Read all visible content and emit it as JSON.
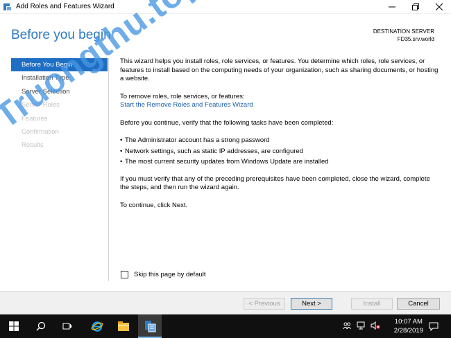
{
  "window": {
    "title": "Add Roles and Features Wizard",
    "controls": [
      "minimize-icon",
      "maximize-icon",
      "close-icon"
    ]
  },
  "header": {
    "page_title": "Before you begin",
    "destination_label": "DESTINATION SERVER",
    "destination_value": "FD35.srv.world"
  },
  "nav": {
    "items": [
      {
        "label": "Before You Begin",
        "state": "active"
      },
      {
        "label": "Installation Type",
        "state": "enabled"
      },
      {
        "label": "Server Selection",
        "state": "enabled"
      },
      {
        "label": "Server Roles",
        "state": "disabled"
      },
      {
        "label": "Features",
        "state": "disabled"
      },
      {
        "label": "Confirmation",
        "state": "disabled"
      },
      {
        "label": "Results",
        "state": "disabled"
      }
    ]
  },
  "main": {
    "intro": "This wizard helps you install roles, role services, or features. You determine which roles, role services, or features to install based on the computing needs of your organization, such as sharing documents, or hosting a website.",
    "remove_heading": "To remove roles, role services, or features:",
    "remove_link": "Start the Remove Roles and Features Wizard",
    "verify_text": "Before you continue, verify that the following tasks have been completed:",
    "bullets": [
      "The Administrator account has a strong password",
      "Network settings, such as static IP addresses, are configured",
      "The most current security updates from Windows Update are installed"
    ],
    "prereq_text": "If you must verify that any of the preceding prerequisites have been completed, close the wizard, complete the steps, and then run the wizard again.",
    "continue_text": "To continue, click Next.",
    "skip_label": "Skip this page by default",
    "skip_checked": false
  },
  "footer": {
    "previous_label": "< Previous",
    "next_label": "Next >",
    "install_label": "Install",
    "cancel_label": "Cancel"
  },
  "taskbar": {
    "time": "10:07 AM",
    "date": "2/28/2019",
    "pinned": [
      "windows-start-icon",
      "search-icon",
      "task-view-icon",
      "internet-explorer-icon",
      "file-explorer-icon",
      "server-manager-icon"
    ],
    "tray": [
      "people-icon",
      "network-icon",
      "volume-muted-icon",
      "notifications-icon"
    ]
  },
  "watermark": {
    "text": "Truongthu.top"
  },
  "colors": {
    "accent": "#1e6fc4",
    "title_blue": "#2c78c2",
    "link_blue": "#1c5fb0",
    "watermark_blue": "#4696e1"
  }
}
